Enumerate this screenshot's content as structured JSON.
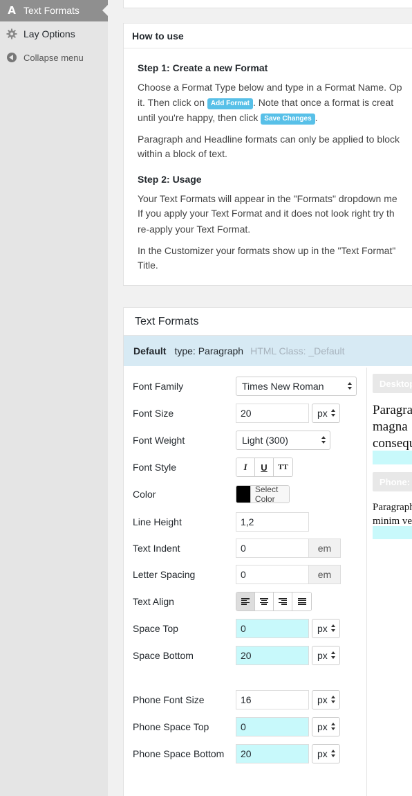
{
  "sidebar": {
    "items": [
      {
        "label": "Text Formats",
        "icon": "text-format-icon",
        "active": true
      },
      {
        "label": "Lay Options",
        "icon": "gear-icon"
      },
      {
        "label": "Collapse menu",
        "icon": "collapse-icon"
      }
    ]
  },
  "howto": {
    "title": "How to use",
    "step1_title": "Step 1: Create a new Format",
    "step1_line1": "Choose a Format Type below and type in a Format Name. Op",
    "step1_line2a": "it. Then click on ",
    "add_format_label": "Add Format",
    "step1_line2b": ". Note that once a format is creat",
    "step1_line3a": "until you're happy, then click ",
    "save_changes_label": "Save Changes",
    "step1_line3b": ".",
    "step1_line4": "Paragraph and Headline formats can only be applied to block",
    "step1_line5": "within a block of text.",
    "step2_title": "Step 2: Usage",
    "step2_line1": "Your Text Formats will appear in the \"Formats\" dropdown me",
    "step2_line2": "If you apply your Text Format and it does not look right try th",
    "step2_line3": "re-apply your Text Format.",
    "step2_line4": "In the Customizer your formats show up in the \"Text Format\"",
    "step2_line5": "Title."
  },
  "formats": {
    "title": "Text Formats",
    "current": {
      "name": "Default",
      "type": "type: Paragraph",
      "html_class": "HTML Class: _Default"
    },
    "fields": {
      "font_family_label": "Font Family",
      "font_family_value": "Times New Roman",
      "font_size_label": "Font Size",
      "font_size_value": "20",
      "font_size_unit": "px",
      "font_weight_label": "Font Weight",
      "font_weight_value": "Light (300)",
      "font_style_label": "Font Style",
      "italic": "I",
      "underline": "U",
      "uppercase": "TT",
      "color_label": "Color",
      "color_value": "#000000",
      "select_color": "Select Color",
      "line_height_label": "Line Height",
      "line_height_value": "1,2",
      "text_indent_label": "Text Indent",
      "text_indent_value": "0",
      "text_indent_unit": "em",
      "letter_spacing_label": "Letter Spacing",
      "letter_spacing_value": "0",
      "letter_spacing_unit": "em",
      "text_align_label": "Text Align",
      "text_align_value": "left",
      "space_top_label": "Space Top",
      "space_top_value": "0",
      "space_top_unit": "px",
      "space_bottom_label": "Space Bottom",
      "space_bottom_value": "20",
      "space_bottom_unit": "px",
      "phone_font_size_label": "Phone Font Size",
      "phone_font_size_value": "16",
      "phone_font_size_unit": "px",
      "phone_space_top_label": "Phone Space Top",
      "phone_space_top_value": "0",
      "phone_space_top_unit": "px",
      "phone_space_bottom_label": "Phone Space Bottom",
      "phone_space_bottom_value": "20",
      "phone_space_bottom_unit": "px"
    },
    "preview": {
      "desktop_tab": "Desktop",
      "desktop_lines": [
        "Paragra",
        "magna",
        "consequ"
      ],
      "phone_tab": "Phone:",
      "phone_lines": [
        "Paragraph",
        "minim ve"
      ]
    }
  },
  "colors": {
    "accent": "#58c0e8",
    "highlight": "#c8f9fb",
    "format_bar": "#d7eaf4"
  }
}
